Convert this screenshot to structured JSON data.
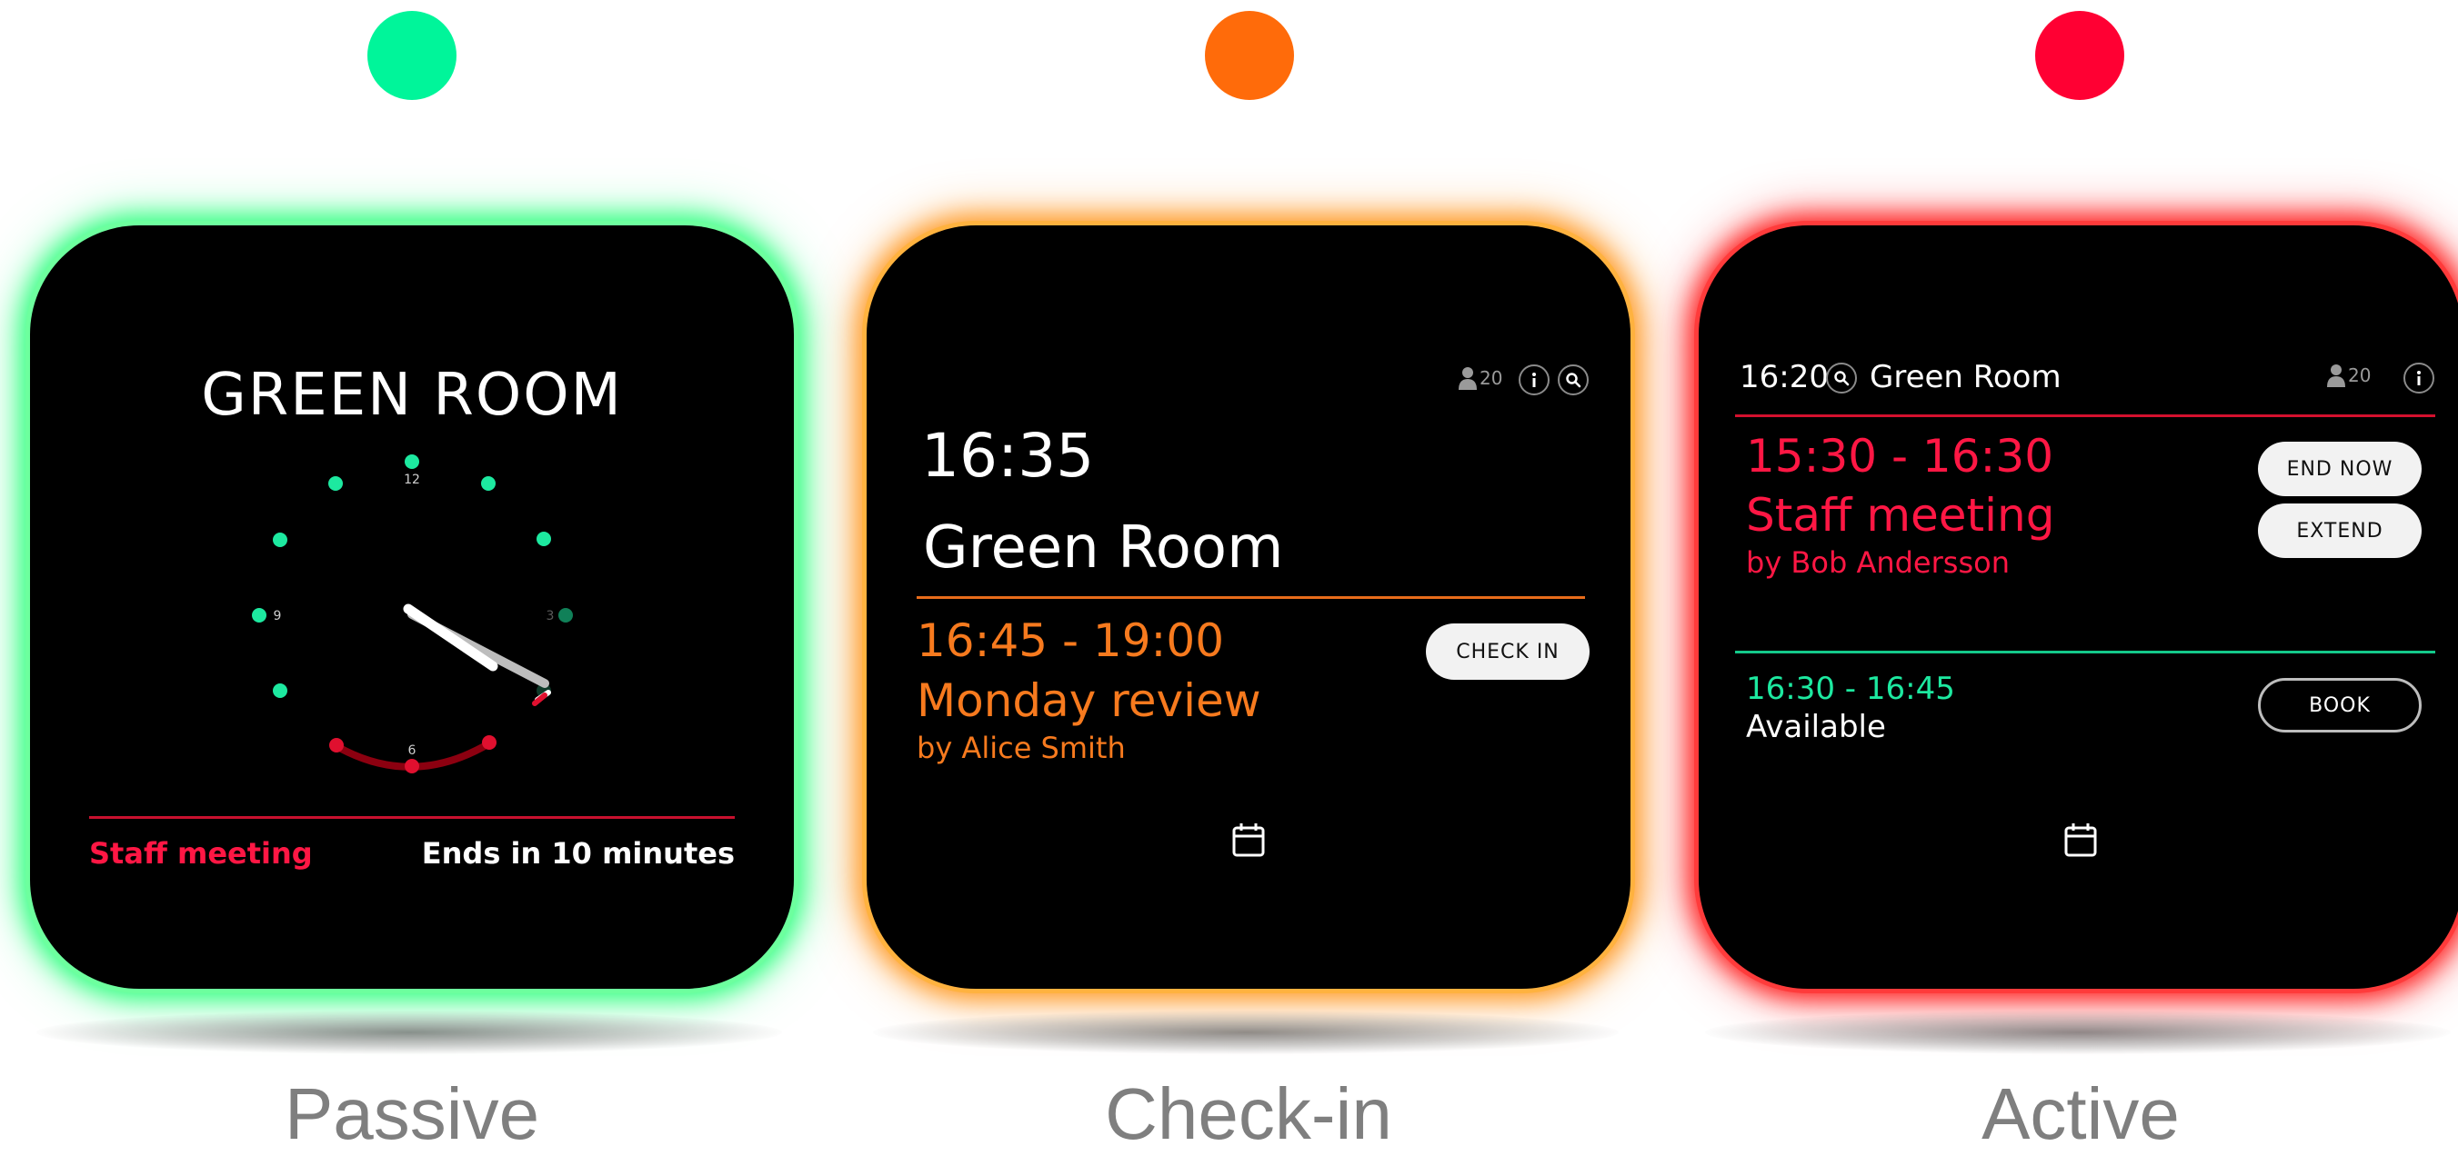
{
  "colors": {
    "passive": "#00F59A",
    "checkin": "#FF6B0A",
    "active": "#FF0033",
    "orange_text": "#F77A1E",
    "red_text": "#FF1744",
    "green_text": "#1DE9A0"
  },
  "passive": {
    "caption": "Passive",
    "room_title": "GREEN ROOM",
    "clock": {
      "num_12": "12",
      "num_3": "3",
      "num_6": "6",
      "num_9": "9"
    },
    "meeting_title": "Staff meeting",
    "ends_text": "Ends in 10 minutes"
  },
  "checkin": {
    "caption": "Check-in",
    "capacity": "20",
    "time": "16:35",
    "room_name": "Green Room",
    "booking": {
      "time_range": "16:45 - 19:00",
      "title": "Monday review",
      "organizer": "by Alice Smith"
    },
    "check_in_label": "CHECK IN"
  },
  "active": {
    "caption": "Active",
    "time": "16:20",
    "room_name": "Green Room",
    "capacity": "20",
    "current": {
      "time_range": "15:30 - 16:30",
      "title": "Staff meeting",
      "organizer": "by Bob Andersson"
    },
    "end_now_label": "END NOW",
    "extend_label": "EXTEND",
    "next": {
      "time_range": "16:30 - 16:45",
      "status": "Available"
    },
    "book_label": "BOOK"
  }
}
